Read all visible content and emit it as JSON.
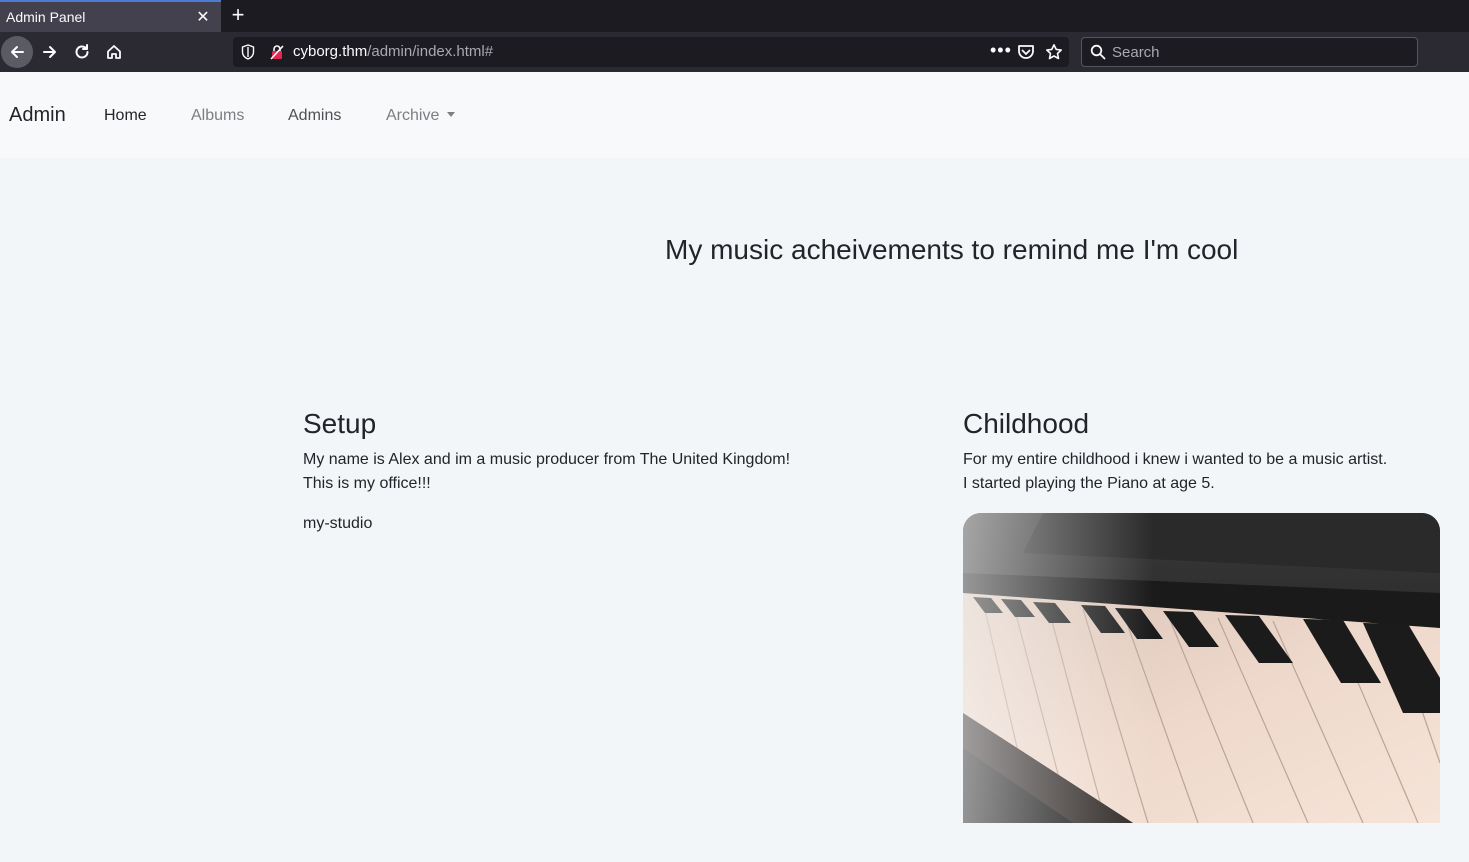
{
  "browser": {
    "tab_title": "Admin Panel",
    "url_host": "cyborg.thm",
    "url_path": "/admin/index.html#",
    "url_dots": "•••",
    "search_placeholder": "Search"
  },
  "site_nav": {
    "brand": "Admin",
    "links": [
      {
        "label": "Home"
      },
      {
        "label": "Albums"
      },
      {
        "label": "Admins"
      },
      {
        "label": "Archive"
      }
    ]
  },
  "hero": {
    "title": "My music acheivements to remind me I'm cool"
  },
  "setup": {
    "heading": "Setup",
    "line1": "My name is Alex and im a music producer from The United Kingdom!",
    "line2": "This is my office!!!",
    "image_alt": "my-studio"
  },
  "childhood": {
    "heading": "Childhood",
    "line1": "For my entire childhood i knew i wanted to be a music artist.",
    "line2": "I started playing the Piano at age 5.",
    "image": "piano-keys-photo"
  },
  "colors": {
    "tab_accent": "#4d7bd6",
    "page_bg": "#f2f6f8",
    "nav_bg": "#f8f9fa",
    "text": "#212529"
  }
}
